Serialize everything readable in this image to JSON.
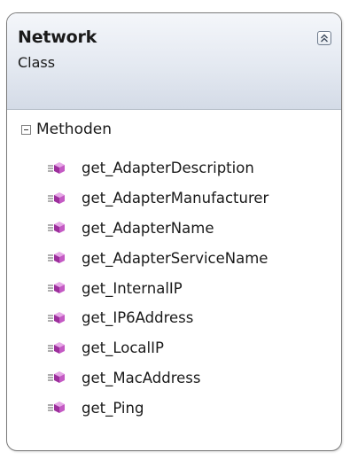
{
  "class_shape": {
    "name": "Network",
    "stereotype": "Class",
    "collapse_icon": "double-chevron-up-icon"
  },
  "compartment": {
    "label": "Methoden",
    "toggle_icon": "minus-box-icon",
    "member_icon": "method-cube-icon",
    "methods": [
      "get_AdapterDescription",
      "get_AdapterManufacturer",
      "get_AdapterName",
      "get_AdapterServiceName",
      "get_InternalIP",
      "get_IP6Address",
      "get_LocalIP",
      "get_MacAddress",
      "get_Ping"
    ]
  },
  "colors": {
    "header_gradient_top": "#f4f6fa",
    "header_gradient_bottom": "#d4dbe7",
    "border": "#7a7a7a",
    "method_icon": "#b046b0"
  }
}
